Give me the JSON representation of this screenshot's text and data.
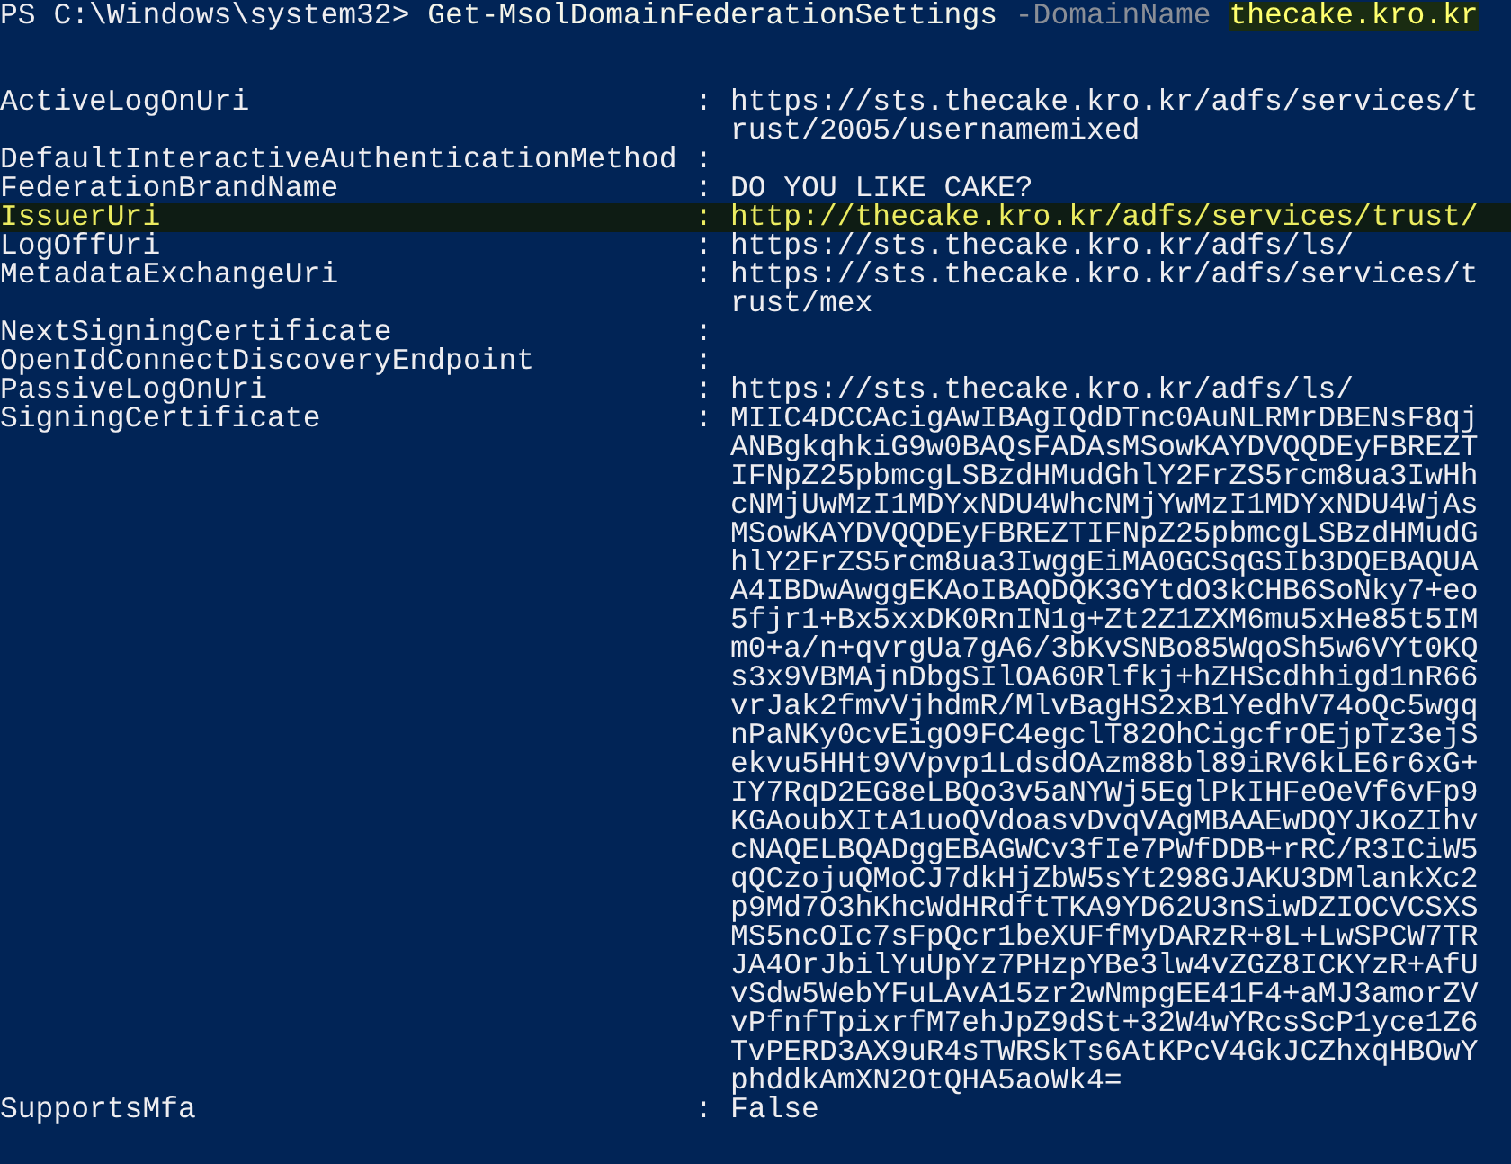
{
  "prompt": [
    {
      "kind": "prompt",
      "text": "PS C:\\Windows\\system32>"
    },
    {
      "kind": "command",
      "text": "Get-MsolDomainFederationSettings"
    },
    {
      "kind": "parameter",
      "text": "-DomainName"
    },
    {
      "kind": "argument",
      "text": "thecake.kro.kr",
      "selected": true
    }
  ],
  "properties": [
    {
      "name": "ActiveLogOnUri",
      "separator": ":",
      "lines": [
        "https://sts.thecake.kro.kr/adfs/services/t",
        "rust/2005/usernamemixed"
      ],
      "selected": false
    },
    {
      "name": "DefaultInteractiveAuthenticationMethod",
      "separator": ":",
      "selected": false
    },
    {
      "name": "FederationBrandName",
      "separator": ":",
      "lines": [
        "DO YOU LIKE CAKE?"
      ],
      "selected": false
    },
    {
      "name": "IssuerUri",
      "separator": ":",
      "lines": [
        "http://thecake.kro.kr/adfs/services/trust/"
      ],
      "selected": true
    },
    {
      "name": "LogOffUri",
      "separator": ":",
      "lines": [
        "https://sts.thecake.kro.kr/adfs/ls/"
      ],
      "selected": false
    },
    {
      "name": "MetadataExchangeUri",
      "separator": ":",
      "lines": [
        "https://sts.thecake.kro.kr/adfs/services/t",
        "rust/mex"
      ],
      "selected": false
    },
    {
      "name": "NextSigningCertificate",
      "separator": ":",
      "selected": false
    },
    {
      "name": "OpenIdConnectDiscoveryEndpoint",
      "separator": ":",
      "selected": false
    },
    {
      "name": "PassiveLogOnUri",
      "separator": ":",
      "lines": [
        "https://sts.thecake.kro.kr/adfs/ls/"
      ],
      "selected": false
    },
    {
      "name": "SigningCertificate",
      "separator": ":",
      "lines": [
        "MIIC4DCCAcigAwIBAgIQdDTnc0AuNLRMrDBENsF8qj",
        "ANBgkqhkiG9w0BAQsFADAsMSowKAYDVQQDEyFBREZT",
        "IFNpZ25pbmcgLSBzdHMudGhlY2FrZS5rcm8ua3IwHh",
        "cNMjUwMzI1MDYxNDU4WhcNMjYwMzI1MDYxNDU4WjAs",
        "MSowKAYDVQQDEyFBREZTIFNpZ25pbmcgLSBzdHMudG",
        "hlY2FrZS5rcm8ua3IwggEiMA0GCSqGSIb3DQEBAQUA",
        "A4IBDwAwggEKAoIBAQDQK3GYtdO3kCHB6SoNky7+eo",
        "5fjr1+Bx5xxDK0RnIN1g+Zt2Z1ZXM6mu5xHe85t5IM",
        "m0+a/n+qvrgUa7gA6/3bKvSNBo85WqoSh5w6VYt0KQ",
        "s3x9VBMAjnDbgSIlOA60Rlfkj+hZHScdhhigd1nR66",
        "vrJak2fmvVjhdmR/MlvBagHS2xB1YedhV74oQc5wgq",
        "nPaNKy0cvEigO9FC4egclT82OhCigcfrOEjpTz3ejS",
        "ekvu5HHt9VVpvp1LdsdOAzm88bl89iRV6kLE6r6xG+",
        "IY7RqD2EG8eLBQo3v5aNYWj5EglPkIHFeOeVf6vFp9",
        "KGAoubXItA1uoQVdoasvDvqVAgMBAAEwDQYJKoZIhv",
        "cNAQELBQADggEBAGWCv3fIe7PWfDDB+rRC/R3ICiW5",
        "qQCzojuQMoCJ7dkHjZbW5sYt298GJAKU3DMlankXc2",
        "p9Md7O3hKhcWdHRdftTKA9YD62U3nSiwDZIOCVCSXS",
        "MS5ncOIc7sFpQcr1beXUFfMyDARzR+8L+LwSPCW7TR",
        "JA4OrJbilYuUpYz7PHzpYBe3lw4vZGZ8ICKYzR+AfU",
        "vSdw5WebYFuLAvA15zr2wNmpgEE41F4+aMJ3amorZV",
        "vPfnfTpixrfM7ehJpZ9dSt+32W4wYRcsScP1yce1Z6",
        "TvPERD3AX9uR4sTWRSkTs6AtKPcV4GkJCZhxqHBOwY",
        "phddkAmXN2OtQHA5aoWk4="
      ],
      "selected": false
    },
    {
      "name": "SupportsMfa",
      "separator": ":",
      "lines": [
        "False"
      ],
      "selected": false
    }
  ]
}
